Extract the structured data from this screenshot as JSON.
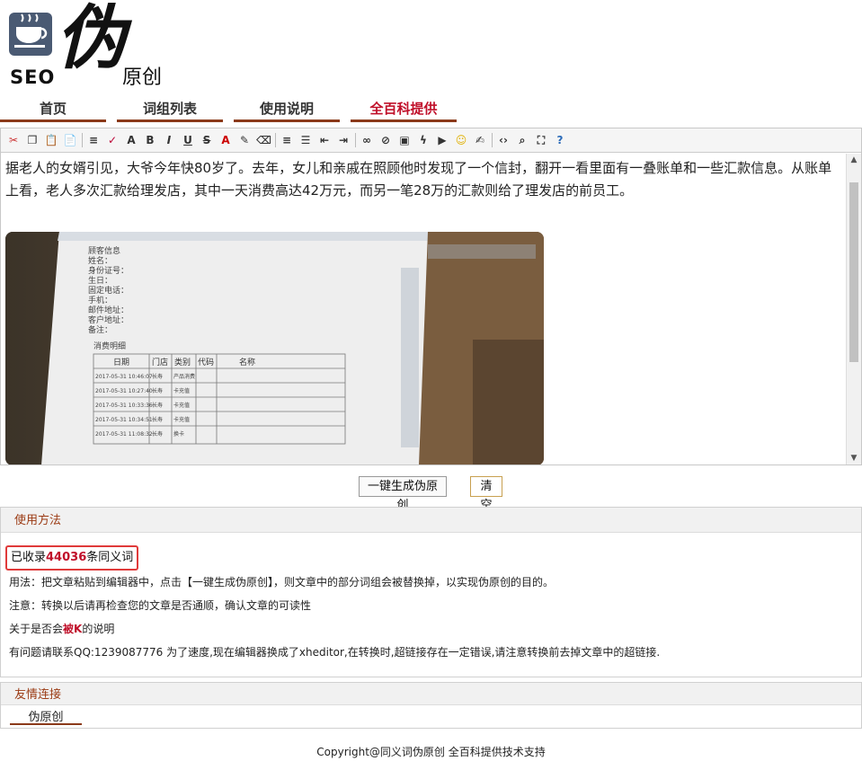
{
  "logo": {
    "seo": "SEO",
    "big": "伪",
    "small": "原创"
  },
  "nav": [
    {
      "label": "首页",
      "active": false
    },
    {
      "label": "词组列表",
      "active": false
    },
    {
      "label": "使用说明",
      "active": false
    },
    {
      "label": "全百科提供",
      "active": true
    }
  ],
  "toolbar_icons": [
    "cut-icon",
    "copy-icon",
    "paste-icon",
    "paste-text-icon",
    "sep",
    "format-icon",
    "spellcheck-icon",
    "font-icon",
    "bold-icon",
    "italic-icon",
    "underline-icon",
    "strikethrough-icon",
    "font-color-icon",
    "highlight-icon",
    "remove-format-icon",
    "sep",
    "align-icon",
    "list-icon",
    "outdent-icon",
    "indent-icon",
    "sep",
    "link-icon",
    "unlink-icon",
    "image-icon",
    "flash-icon",
    "media-icon",
    "emoticon-icon",
    "edit-icon",
    "sep",
    "source-icon",
    "preview-icon",
    "fullscreen-icon",
    "about-icon"
  ],
  "editor": {
    "paragraph": "据老人的女婿引见，大爷今年快80岁了。去年，女儿和亲戚在照顾他时发现了一个信封，翻开一看里面有一叠账单和一些汇款信息。从账单上看，老人多次汇款给理发店，其中一天消费高达42万元，而另一笔28万的汇款则给了理发店的前员工。",
    "photo": {
      "heading": "消费明细",
      "columns": [
        "日期",
        "门店",
        "类别",
        "代码",
        "名称"
      ],
      "rows": [
        [
          "2017-05-31 10:46:07",
          "长寿",
          "产品消费"
        ],
        [
          "2017-05-31 10:27:40",
          "长寿",
          "卡充值"
        ],
        [
          "2017-05-31 10:33:36",
          "长寿",
          "卡充值"
        ],
        [
          "2017-05-31 10:34:51",
          "长寿",
          "卡充值"
        ],
        [
          "2017-05-31 11:08:32",
          "长寿",
          "换卡"
        ]
      ],
      "fields": [
        "顾客信息",
        "姓名：",
        "身份证号：",
        "生日：",
        "固定电话：",
        "手机：",
        "邮件地址：",
        "客户地址：",
        "备注："
      ]
    }
  },
  "buttons": {
    "generate": "一键生成伪原创",
    "clear": "清空"
  },
  "usage": {
    "header": "使用方法",
    "count_prefix": "已收录",
    "count": "44036",
    "count_suffix": "条同义词",
    "line1": "用法：把文章粘贴到编辑器中，点击【一键生成伪原创】，则文章中的部分词组会被替换掉，以实现伪原创的目的。",
    "line2": "注意：转换以后请再检查您的文章是否通顺，确认文章的可读性",
    "line3_prefix": "关于是否会",
    "line3_red": "被K",
    "line3_suffix": "的说明",
    "line4": "有问题请联系QQ:1239087776 为了速度,现在编辑器换成了xheditor,在转换时,超链接存在一定错误,请注意转换前去掉文章中的超链接."
  },
  "friends": {
    "header": "友情连接",
    "links": [
      "伪原创"
    ]
  },
  "footer": "Copyright@同义词伪原创 全百科提供技术支持"
}
